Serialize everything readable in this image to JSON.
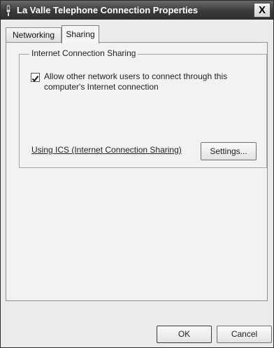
{
  "window": {
    "title": "La Valle Telephone Connection Properties",
    "close_glyph": "X"
  },
  "tabs": [
    {
      "label": "Networking",
      "selected": false
    },
    {
      "label": "Sharing",
      "selected": true
    }
  ],
  "ics_group": {
    "label": "Internet Connection Sharing",
    "allow_checkbox": {
      "checked": true,
      "label": "Allow other network users to connect through this computer's Internet connection"
    },
    "help_link": "Using ICS (Internet Connection Sharing)",
    "settings_button": "Settings..."
  },
  "footer": {
    "ok_label": "OK",
    "cancel_label": "Cancel"
  },
  "icons": {
    "title_icon": "network-connection-icon",
    "check_icon": "checkmark-icon"
  }
}
